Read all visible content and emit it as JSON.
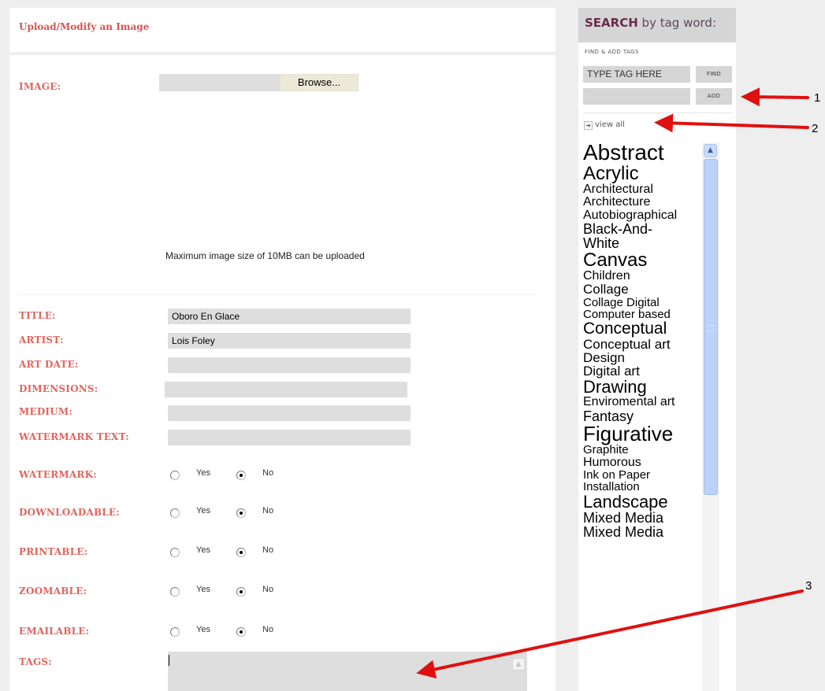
{
  "header": {
    "title": "Upload/Modify an Image"
  },
  "form": {
    "image_label": "IMAGE:",
    "browse_label": "Browse...",
    "max_size_note": "Maximum image size of 10MB can be uploaded",
    "fields": [
      {
        "label": "TITLE:",
        "value": "Oboro En Glace"
      },
      {
        "label": "ARTIST:",
        "value": "Lois Foley"
      },
      {
        "label": "ART DATE:",
        "value": ""
      },
      {
        "label": "DIMENSIONS:",
        "value": ""
      },
      {
        "label": "MEDIUM:",
        "value": ""
      },
      {
        "label": "WATERMARK TEXT:",
        "value": ""
      }
    ],
    "radios": [
      {
        "label": "WATERMARK:",
        "selected": "No"
      },
      {
        "label": "DOWNLOADABLE:",
        "selected": "No"
      },
      {
        "label": "PRINTABLE:",
        "selected": "No"
      },
      {
        "label": "ZOOMABLE:",
        "selected": "No"
      },
      {
        "label": "EMAILABLE:",
        "selected": "No"
      }
    ],
    "yes_label": "Yes",
    "no_label": "No",
    "tags_label": "TAGS:",
    "tags_value": ""
  },
  "sidebar": {
    "search_bold": "SEARCH",
    "search_rest": " by tag word:",
    "find_add_label": "FIND & ADD TAGS",
    "tag_input_value": "TYPE TAG HERE",
    "find_button": "FIND",
    "add_input_value": "",
    "add_button": "ADD",
    "view_all": "view all",
    "tags": [
      {
        "text": "Abstract",
        "size": 28
      },
      {
        "text": "Acrylic",
        "size": 24
      },
      {
        "text": "Architectural",
        "size": 16
      },
      {
        "text": "Architecture",
        "size": 16
      },
      {
        "text": "Autobiographical",
        "size": 16
      },
      {
        "text": "Black-And-",
        "size": 18
      },
      {
        "text": "White",
        "size": 18
      },
      {
        "text": "Canvas",
        "size": 24
      },
      {
        "text": "Children",
        "size": 16
      },
      {
        "text": "Collage",
        "size": 17
      },
      {
        "text": "Collage Digital",
        "size": 15
      },
      {
        "text": "Computer based",
        "size": 15
      },
      {
        "text": "Conceptual",
        "size": 21
      },
      {
        "text": "Conceptual art",
        "size": 17
      },
      {
        "text": "Design",
        "size": 17
      },
      {
        "text": "Digital art",
        "size": 17
      },
      {
        "text": "Drawing",
        "size": 22
      },
      {
        "text": "Enviromental art",
        "size": 16
      },
      {
        "text": "Fantasy",
        "size": 18
      },
      {
        "text": "Figurative",
        "size": 26
      },
      {
        "text": "Graphite",
        "size": 15
      },
      {
        "text": "Humorous",
        "size": 16
      },
      {
        "text": "Ink on Paper",
        "size": 15
      },
      {
        "text": "Installation",
        "size": 15
      },
      {
        "text": "Landscape",
        "size": 22
      },
      {
        "text": "Mixed Media",
        "size": 18
      },
      {
        "text": "Mixed Media",
        "size": 18
      }
    ]
  },
  "colors": {
    "label_color": "#e0655d",
    "search_title_color": "#6c2b4b",
    "scroll_thumb": "#bcd2fa",
    "annotation": "#e01010"
  },
  "annotations": [
    "1",
    "2",
    "3"
  ]
}
